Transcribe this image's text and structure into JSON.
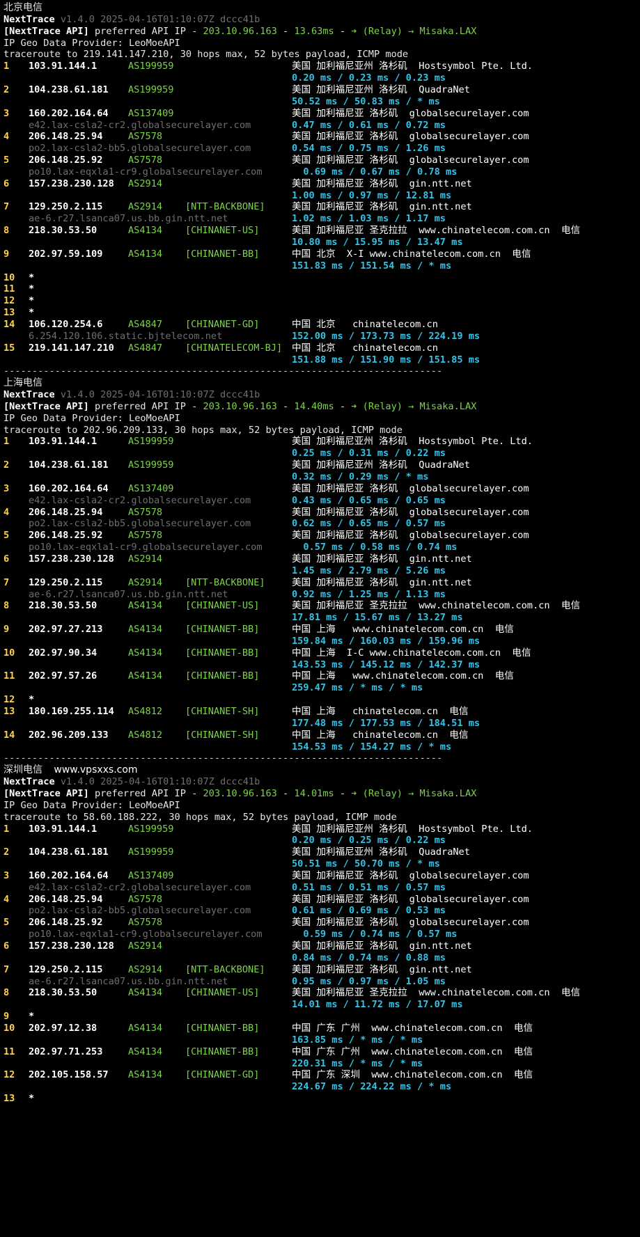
{
  "version_line": {
    "name": "NextTrace",
    "meta": "v1.4.0 2025-04-16T01:10:07Z dccc41b"
  },
  "api_line": {
    "prefix": "[NextTrace API]",
    "mid": "preferred API IP - ",
    "ip": "203.10.96.163",
    "sep": " - ",
    "relay": "Misaka.LAX",
    "relay_prefix": "➔ (Relay) → "
  },
  "geo_provider": "IP Geo Data Provider: LeoMoeAPI",
  "separator": "-----------------------------------------------------------------------------",
  "sections": [
    {
      "title": "北京电信",
      "extra": "",
      "latency": "13.63ms",
      "traceroute": "traceroute to 219.141.147.210, 30 hops max, 52 bytes payload, ICMP mode",
      "hops": [
        {
          "n": "1",
          "ip": "103.91.144.1",
          "as": "AS199959",
          "tag": "",
          "geo": "美国 加利福尼亚州 洛杉矶  Hostsymbol Pte. Ltd.",
          "host": "",
          "rtt": "0.20 ms / 0.23 ms / 0.23 ms"
        },
        {
          "n": "2",
          "ip": "104.238.61.181",
          "as": "AS199959",
          "tag": "",
          "geo": "美国 加利福尼亚州 洛杉矶  QuadraNet",
          "host": "",
          "rtt": "50.52 ms / 50.83 ms / * ms"
        },
        {
          "n": "3",
          "ip": "160.202.164.64",
          "as": "AS137409",
          "tag": "",
          "geo": "美国 加利福尼亚 洛杉矶  globalsecurelayer.com",
          "host": "e42.lax-csla2-cr2.globalsecurelayer.com",
          "rtt": "0.47 ms / 0.61 ms / 0.72 ms"
        },
        {
          "n": "4",
          "ip": "206.148.25.94",
          "as": "AS7578",
          "tag": "",
          "geo": "美国 加利福尼亚 洛杉矶  globalsecurelayer.com",
          "host": "po2.lax-csla2-bb5.globalsecurelayer.com",
          "rtt": "0.54 ms / 0.75 ms / 1.26 ms"
        },
        {
          "n": "5",
          "ip": "206.148.25.92",
          "as": "AS7578",
          "tag": "",
          "geo": "美国 加利福尼亚 洛杉矶  globalsecurelayer.com",
          "host": "po10.lax-eqxla1-cr9.globalsecurelayer.com",
          "rtt": "  0.69 ms / 0.67 ms / 0.78 ms"
        },
        {
          "n": "6",
          "ip": "157.238.230.128",
          "as": "AS2914",
          "tag": "",
          "geo": "美国 加利福尼亚 洛杉矶  gin.ntt.net",
          "host": "",
          "rtt": "1.00 ms / 0.97 ms / 12.81 ms"
        },
        {
          "n": "7",
          "ip": "129.250.2.115",
          "as": "AS2914",
          "tag": "[NTT-BACKBONE]",
          "geo": "美国 加利福尼亚 洛杉矶  gin.ntt.net",
          "host": "ae-6.r27.lsanca07.us.bb.gin.ntt.net",
          "rtt": "1.02 ms / 1.03 ms / 1.17 ms"
        },
        {
          "n": "8",
          "ip": "218.30.53.50",
          "as": "AS4134",
          "tag": "[CHINANET-US]",
          "geo": "美国 加利福尼亚 圣克拉拉  www.chinatelecom.com.cn  电信",
          "host": "",
          "rtt": "10.80 ms / 15.95 ms / 13.47 ms"
        },
        {
          "n": "9",
          "ip": "202.97.59.109",
          "as": "AS4134",
          "tag": "[CHINANET-BB]",
          "geo": "中国 北京  X-I www.chinatelecom.com.cn  电信",
          "host": "",
          "rtt": "151.83 ms / 151.54 ms / * ms"
        },
        {
          "n": "10",
          "ip": "*",
          "as": "",
          "tag": "",
          "geo": "",
          "host": "",
          "rtt": ""
        },
        {
          "n": "11",
          "ip": "*",
          "as": "",
          "tag": "",
          "geo": "",
          "host": "",
          "rtt": ""
        },
        {
          "n": "12",
          "ip": "*",
          "as": "",
          "tag": "",
          "geo": "",
          "host": "",
          "rtt": ""
        },
        {
          "n": "13",
          "ip": "*",
          "as": "",
          "tag": "",
          "geo": "",
          "host": "",
          "rtt": ""
        },
        {
          "n": "14",
          "ip": "106.120.254.6",
          "as": "AS4847",
          "tag": "[CHINANET-GD]",
          "geo": "中国 北京   chinatelecom.cn",
          "host": "6.254.120.106.static.bjtelecom.net",
          "rtt": "152.00 ms / 173.73 ms / 224.19 ms"
        },
        {
          "n": "15",
          "ip": "219.141.147.210",
          "as": "AS4847",
          "tag": "[CHINATELECOM-BJ]",
          "geo": "中国 北京   chinatelecom.cn",
          "host": "",
          "rtt": "151.88 ms / 151.90 ms / 151.85 ms"
        }
      ]
    },
    {
      "title": "上海电信",
      "extra": "",
      "latency": "14.40ms",
      "traceroute": "traceroute to 202.96.209.133, 30 hops max, 52 bytes payload, ICMP mode",
      "hops": [
        {
          "n": "1",
          "ip": "103.91.144.1",
          "as": "AS199959",
          "tag": "",
          "geo": "美国 加利福尼亚州 洛杉矶  Hostsymbol Pte. Ltd.",
          "host": "",
          "rtt": "0.25 ms / 0.31 ms / 0.22 ms"
        },
        {
          "n": "2",
          "ip": "104.238.61.181",
          "as": "AS199959",
          "tag": "",
          "geo": "美国 加利福尼亚州 洛杉矶  QuadraNet",
          "host": "",
          "rtt": "0.32 ms / 0.29 ms / * ms"
        },
        {
          "n": "3",
          "ip": "160.202.164.64",
          "as": "AS137409",
          "tag": "",
          "geo": "美国 加利福尼亚 洛杉矶  globalsecurelayer.com",
          "host": "e42.lax-csla2-cr2.globalsecurelayer.com",
          "rtt": "0.43 ms / 0.65 ms / 0.65 ms"
        },
        {
          "n": "4",
          "ip": "206.148.25.94",
          "as": "AS7578",
          "tag": "",
          "geo": "美国 加利福尼亚 洛杉矶  globalsecurelayer.com",
          "host": "po2.lax-csla2-bb5.globalsecurelayer.com",
          "rtt": "0.62 ms / 0.65 ms / 0.57 ms"
        },
        {
          "n": "5",
          "ip": "206.148.25.92",
          "as": "AS7578",
          "tag": "",
          "geo": "美国 加利福尼亚 洛杉矶  globalsecurelayer.com",
          "host": "po10.lax-eqxla1-cr9.globalsecurelayer.com",
          "rtt": "  0.57 ms / 0.58 ms / 0.74 ms"
        },
        {
          "n": "6",
          "ip": "157.238.230.128",
          "as": "AS2914",
          "tag": "",
          "geo": "美国 加利福尼亚 洛杉矶  gin.ntt.net",
          "host": "",
          "rtt": "1.45 ms / 2.79 ms / 5.26 ms"
        },
        {
          "n": "7",
          "ip": "129.250.2.115",
          "as": "AS2914",
          "tag": "[NTT-BACKBONE]",
          "geo": "美国 加利福尼亚 洛杉矶  gin.ntt.net",
          "host": "ae-6.r27.lsanca07.us.bb.gin.ntt.net",
          "rtt": "0.92 ms / 1.25 ms / 1.13 ms"
        },
        {
          "n": "8",
          "ip": "218.30.53.50",
          "as": "AS4134",
          "tag": "[CHINANET-US]",
          "geo": "美国 加利福尼亚 圣克拉拉  www.chinatelecom.com.cn  电信",
          "host": "",
          "rtt": "17.81 ms / 15.67 ms / 13.27 ms"
        },
        {
          "n": "9",
          "ip": "202.97.27.213",
          "as": "AS4134",
          "tag": "[CHINANET-BB]",
          "geo": "中国 上海   www.chinatelecom.com.cn  电信",
          "host": "",
          "rtt": "159.84 ms / 160.03 ms / 159.96 ms"
        },
        {
          "n": "10",
          "ip": "202.97.90.34",
          "as": "AS4134",
          "tag": "[CHINANET-BB]",
          "geo": "中国 上海  I-C www.chinatelecom.com.cn  电信",
          "host": "",
          "rtt": "143.53 ms / 145.12 ms / 142.37 ms"
        },
        {
          "n": "11",
          "ip": "202.97.57.26",
          "as": "AS4134",
          "tag": "[CHINANET-BB]",
          "geo": "中国 上海   www.chinatelecom.com.cn  电信",
          "host": "",
          "rtt": "259.47 ms / * ms / * ms"
        },
        {
          "n": "12",
          "ip": "*",
          "as": "",
          "tag": "",
          "geo": "",
          "host": "",
          "rtt": ""
        },
        {
          "n": "13",
          "ip": "180.169.255.114",
          "as": "AS4812",
          "tag": "[CHINANET-SH]",
          "geo": "中国 上海   chinatelecom.cn  电信",
          "host": "",
          "rtt": "177.48 ms / 177.53 ms / 184.51 ms"
        },
        {
          "n": "14",
          "ip": "202.96.209.133",
          "as": "AS4812",
          "tag": "[CHINANET-SH]",
          "geo": "中国 上海   chinatelecom.cn  电信",
          "host": "",
          "rtt": "154.53 ms / 154.27 ms / * ms"
        }
      ]
    },
    {
      "title": "深圳电信",
      "extra": "www.vpsxxs.com",
      "latency": "14.01ms",
      "traceroute": "traceroute to 58.60.188.222, 30 hops max, 52 bytes payload, ICMP mode",
      "hops": [
        {
          "n": "1",
          "ip": "103.91.144.1",
          "as": "AS199959",
          "tag": "",
          "geo": "美国 加利福尼亚州 洛杉矶  Hostsymbol Pte. Ltd.",
          "host": "",
          "rtt": "0.20 ms / 0.25 ms / 0.22 ms"
        },
        {
          "n": "2",
          "ip": "104.238.61.181",
          "as": "AS199959",
          "tag": "",
          "geo": "美国 加利福尼亚州 洛杉矶  QuadraNet",
          "host": "",
          "rtt": "50.51 ms / 50.70 ms / * ms"
        },
        {
          "n": "3",
          "ip": "160.202.164.64",
          "as": "AS137409",
          "tag": "",
          "geo": "美国 加利福尼亚 洛杉矶  globalsecurelayer.com",
          "host": "e42.lax-csla2-cr2.globalsecurelayer.com",
          "rtt": "0.51 ms / 0.51 ms / 0.57 ms"
        },
        {
          "n": "4",
          "ip": "206.148.25.94",
          "as": "AS7578",
          "tag": "",
          "geo": "美国 加利福尼亚 洛杉矶  globalsecurelayer.com",
          "host": "po2.lax-csla2-bb5.globalsecurelayer.com",
          "rtt": "0.61 ms / 0.69 ms / 0.53 ms"
        },
        {
          "n": "5",
          "ip": "206.148.25.92",
          "as": "AS7578",
          "tag": "",
          "geo": "美国 加利福尼亚 洛杉矶  globalsecurelayer.com",
          "host": "po10.lax-eqxla1-cr9.globalsecurelayer.com",
          "rtt": "  0.59 ms / 0.74 ms / 0.57 ms"
        },
        {
          "n": "6",
          "ip": "157.238.230.128",
          "as": "AS2914",
          "tag": "",
          "geo": "美国 加利福尼亚 洛杉矶  gin.ntt.net",
          "host": "",
          "rtt": "0.84 ms / 0.74 ms / 0.88 ms"
        },
        {
          "n": "7",
          "ip": "129.250.2.115",
          "as": "AS2914",
          "tag": "[NTT-BACKBONE]",
          "geo": "美国 加利福尼亚 洛杉矶  gin.ntt.net",
          "host": "ae-6.r27.lsanca07.us.bb.gin.ntt.net",
          "rtt": "0.95 ms / 0.97 ms / 1.05 ms"
        },
        {
          "n": "8",
          "ip": "218.30.53.50",
          "as": "AS4134",
          "tag": "[CHINANET-US]",
          "geo": "美国 加利福尼亚 圣克拉拉  www.chinatelecom.com.cn  电信",
          "host": "",
          "rtt": "14.01 ms / 11.72 ms / 17.07 ms"
        },
        {
          "n": "9",
          "ip": "*",
          "as": "",
          "tag": "",
          "geo": "",
          "host": "",
          "rtt": ""
        },
        {
          "n": "10",
          "ip": "202.97.12.38",
          "as": "AS4134",
          "tag": "[CHINANET-BB]",
          "geo": "中国 广东 广州  www.chinatelecom.com.cn  电信",
          "host": "",
          "rtt": "163.85 ms / * ms / * ms"
        },
        {
          "n": "11",
          "ip": "202.97.71.253",
          "as": "AS4134",
          "tag": "[CHINANET-BB]",
          "geo": "中国 广东 广州  www.chinatelecom.com.cn  电信",
          "host": "",
          "rtt": "220.31 ms / * ms / * ms"
        },
        {
          "n": "12",
          "ip": "202.105.158.57",
          "as": "AS4134",
          "tag": "[CHINANET-GD]",
          "geo": "中国 广东 深圳  www.chinatelecom.com.cn  电信",
          "host": "",
          "rtt": "224.67 ms / 224.22 ms / * ms"
        },
        {
          "n": "13",
          "ip": "*",
          "as": "",
          "tag": "",
          "geo": "",
          "host": "",
          "rtt": ""
        }
      ]
    }
  ]
}
